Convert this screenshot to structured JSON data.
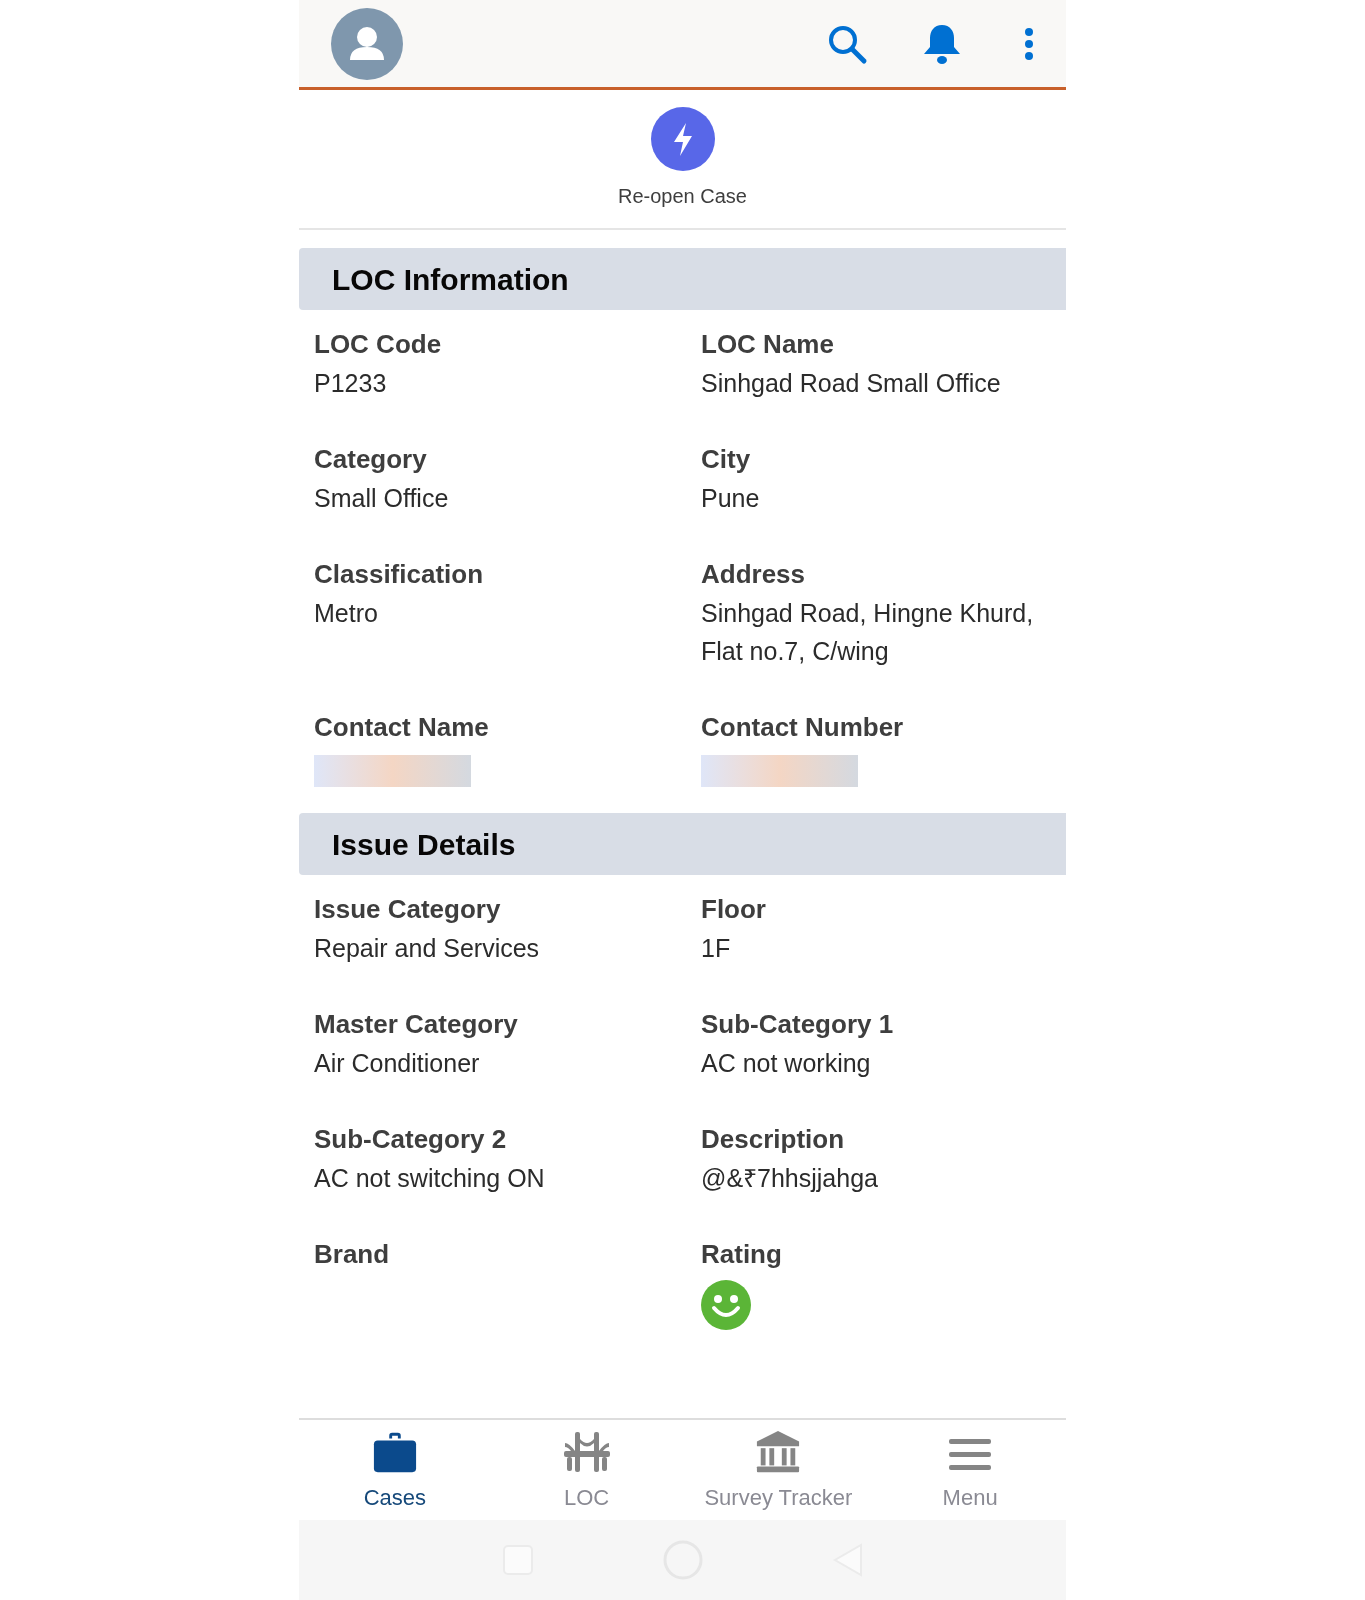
{
  "action": {
    "label": "Re-open Case"
  },
  "sections": [
    {
      "title": "LOC Information",
      "fields": [
        {
          "label": "LOC Code",
          "kind": "text",
          "value": "P1233"
        },
        {
          "label": "LOC Name",
          "kind": "text",
          "value": "Sinhgad Road Small Office"
        },
        {
          "label": "Category",
          "kind": "text",
          "value": "Small Office"
        },
        {
          "label": "City",
          "kind": "text",
          "value": "Pune"
        },
        {
          "label": "Classification",
          "kind": "text",
          "value": "Metro"
        },
        {
          "label": "Address",
          "kind": "text",
          "value": "Sinhgad Road, Hingne Khurd, Flat no.7, C/wing"
        },
        {
          "label": "Contact Name",
          "kind": "redacted"
        },
        {
          "label": "Contact Number",
          "kind": "redacted"
        }
      ]
    },
    {
      "title": "Issue Details",
      "fields": [
        {
          "label": "Issue Category",
          "kind": "text",
          "value": "Repair and Services"
        },
        {
          "label": "Floor",
          "kind": "text",
          "value": "1F"
        },
        {
          "label": "Master Category",
          "kind": "text",
          "value": "Air Conditioner"
        },
        {
          "label": "Sub-Category 1",
          "kind": "text",
          "value": "AC not working"
        },
        {
          "label": "Sub-Category 2",
          "kind": "text",
          "value": "AC not switching ON"
        },
        {
          "label": "Description",
          "kind": "text",
          "value": "@&₹7hhsjjahga"
        },
        {
          "label": "Brand",
          "kind": "text"
        },
        {
          "label": "Rating",
          "kind": "rating"
        }
      ]
    }
  ],
  "nav": [
    {
      "label": "Cases",
      "selected": true
    },
    {
      "label": "LOC",
      "selected": false
    },
    {
      "label": "Survey Tracker",
      "selected": false
    },
    {
      "label": "Menu",
      "selected": false
    }
  ]
}
